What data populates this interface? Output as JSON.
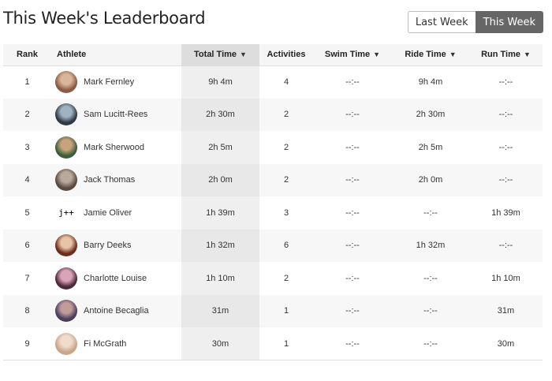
{
  "page_title": "This Week's Leaderboard",
  "toggle": {
    "last_week": "Last Week",
    "this_week": "This Week"
  },
  "columns": {
    "rank": "Rank",
    "athlete": "Athlete",
    "total": "Total Time",
    "activities": "Activities",
    "swim": "Swim Time",
    "ride": "Ride Time",
    "run": "Run Time",
    "sort_icon": "▼"
  },
  "rows": [
    {
      "rank": "1",
      "name": "Mark Fernley",
      "total": "9h 4m",
      "activities": "4",
      "swim": "--:--",
      "ride": "9h 4m",
      "run": "--:--",
      "avatar_colors": [
        "#8a5a44",
        "#d9b59b"
      ]
    },
    {
      "rank": "2",
      "name": "Sam Lucitt-Rees",
      "total": "2h 30m",
      "activities": "2",
      "swim": "--:--",
      "ride": "2h 30m",
      "run": "--:--",
      "avatar_colors": [
        "#2f3a44",
        "#9fb3c2"
      ]
    },
    {
      "rank": "3",
      "name": "Mark Sherwood",
      "total": "2h 5m",
      "activities": "2",
      "swim": "--:--",
      "ride": "2h 5m",
      "run": "--:--",
      "avatar_colors": [
        "#3b5e3a",
        "#c7a27c"
      ]
    },
    {
      "rank": "4",
      "name": "Jack Thomas",
      "total": "2h 0m",
      "activities": "2",
      "swim": "--:--",
      "ride": "2h 0m",
      "run": "--:--",
      "avatar_colors": [
        "#5b4a3f",
        "#b8a99a"
      ]
    },
    {
      "rank": "5",
      "name": "Jamie Oliver",
      "avatar_text": "j++",
      "total": "1h 39m",
      "activities": "3",
      "swim": "--:--",
      "ride": "--:--",
      "run": "1h 39m"
    },
    {
      "rank": "6",
      "name": "Barry Deeks",
      "total": "1h 32m",
      "activities": "6",
      "swim": "--:--",
      "ride": "1h 32m",
      "run": "--:--",
      "avatar_colors": [
        "#6a2c1d",
        "#e8c4a6"
      ]
    },
    {
      "rank": "7",
      "name": "Charlotte Louise",
      "total": "1h 10m",
      "activities": "2",
      "swim": "--:--",
      "ride": "--:--",
      "run": "1h 10m",
      "avatar_colors": [
        "#4a2a3a",
        "#d9a3b8"
      ]
    },
    {
      "rank": "8",
      "name": "Antoine Becaglia",
      "total": "31m",
      "activities": "1",
      "swim": "--:--",
      "ride": "--:--",
      "run": "31m",
      "avatar_colors": [
        "#4b3f5e",
        "#c29b9b"
      ]
    },
    {
      "rank": "9",
      "name": "Fi McGrath",
      "total": "30m",
      "activities": "1",
      "swim": "--:--",
      "ride": "--:--",
      "run": "30m",
      "avatar_colors": [
        "#c9a58a",
        "#f1dccb"
      ]
    }
  ]
}
